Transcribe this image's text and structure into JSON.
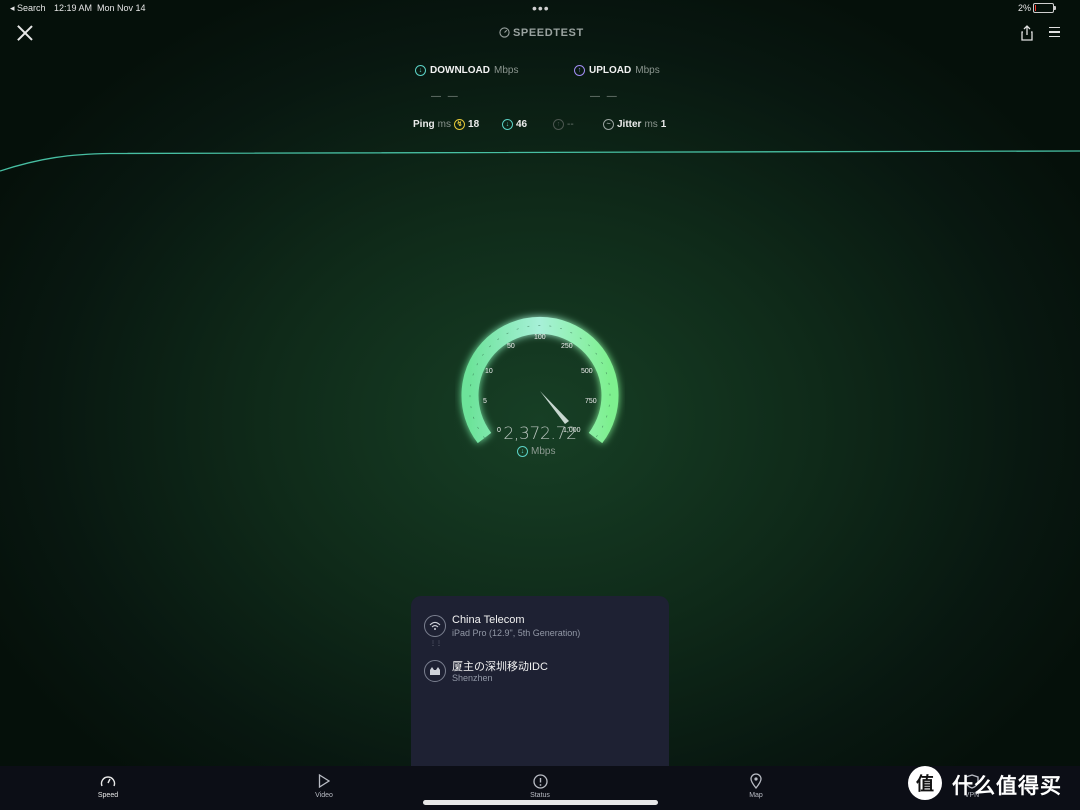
{
  "status_bar": {
    "back": "◂ Search",
    "time": "12:19 AM",
    "date": "Mon Nov 14",
    "battery": "2%"
  },
  "header": {
    "brand": "SPEEDTEST",
    "close_icon": "close-icon",
    "share_icon": "share-icon",
    "menu_icon": "hamburger-menu-icon"
  },
  "download": {
    "label": "DOWNLOAD",
    "unit": "Mbps",
    "value": "— —"
  },
  "upload": {
    "label": "UPLOAD",
    "unit": "Mbps",
    "value": "— —"
  },
  "latency": {
    "ping_label": "Ping",
    "ping_unit": "ms",
    "ping_idle": "18",
    "ping_download": "46",
    "ping_upload": "--",
    "jitter_label": "Jitter",
    "jitter_unit": "ms",
    "jitter": "1"
  },
  "gauge": {
    "scale": [
      "0",
      "5",
      "10",
      "50",
      "100",
      "250",
      "500",
      "750",
      "1,000"
    ],
    "reading": "2,372.72",
    "unit": "Mbps",
    "accent": "#5cf08a"
  },
  "server_panel": {
    "provider_name": "China Telecom",
    "provider_device": "iPad Pro (12.9\", 5th Generation)",
    "server_name": "厦主の深圳移动IDC",
    "server_location": "Shenzhen"
  },
  "tabs": [
    {
      "label": "Speed",
      "icon": "speedometer-icon"
    },
    {
      "label": "Video",
      "icon": "play-icon"
    },
    {
      "label": "Status",
      "icon": "alert-icon"
    },
    {
      "label": "Map",
      "icon": "map-pin-icon"
    },
    {
      "label": "VPN",
      "icon": "vpn-icon"
    }
  ],
  "watermark": {
    "logo": "值",
    "text": "什么值得买"
  },
  "colors": {
    "line": "#4fd1b3",
    "panel": "#1e2133",
    "tabbar": "#0c0e16"
  }
}
